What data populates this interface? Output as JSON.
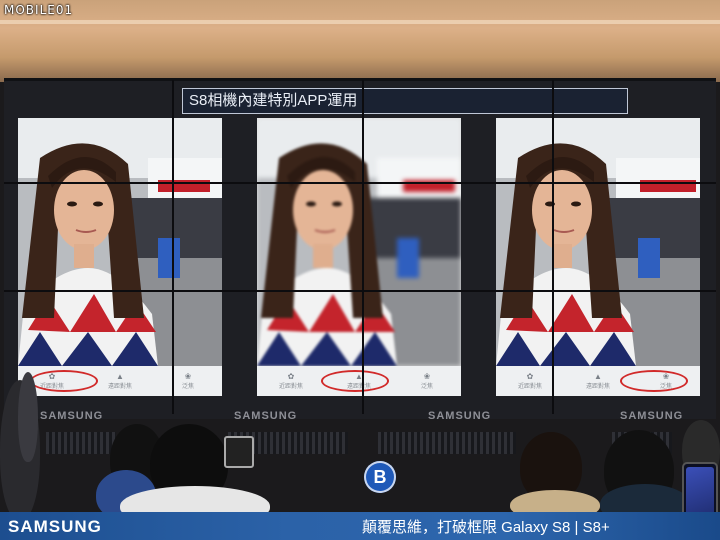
{
  "watermark": {
    "logo_text": "MOBILE01"
  },
  "screen": {
    "header": "S8相機內建特別APP運用",
    "panels": [
      {
        "focus": "sharp",
        "highlighted_mode": 0
      },
      {
        "focus": "blurred",
        "highlighted_mode": 1
      },
      {
        "focus": "sharp",
        "highlighted_mode": 2
      }
    ],
    "modes": [
      "近距對焦",
      "遠距對焦",
      "泛焦"
    ],
    "highlight_color": "#d12a2a"
  },
  "wall": {
    "brand_labels": [
      "SAMSUNG",
      "SAMSUNG",
      "SAMSUNG",
      "SAMSUNG"
    ],
    "badge": "B"
  },
  "banner": {
    "brand": "SAMSUNG",
    "slogan": "顛覆思維，打破框限   Galaxy S8 | S8+",
    "color": "#2b62a8"
  }
}
